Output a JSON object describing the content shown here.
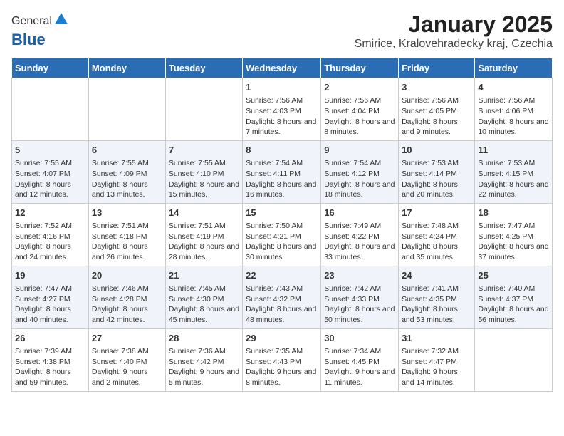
{
  "header": {
    "logo_general": "General",
    "logo_blue": "Blue",
    "month_title": "January 2025",
    "location": "Smirice, Kralovehradecky kraj, Czechia"
  },
  "days_of_week": [
    "Sunday",
    "Monday",
    "Tuesday",
    "Wednesday",
    "Thursday",
    "Friday",
    "Saturday"
  ],
  "weeks": [
    [
      {
        "day": "",
        "detail": ""
      },
      {
        "day": "",
        "detail": ""
      },
      {
        "day": "",
        "detail": ""
      },
      {
        "day": "1",
        "detail": "Sunrise: 7:56 AM\nSunset: 4:03 PM\nDaylight: 8 hours and 7 minutes."
      },
      {
        "day": "2",
        "detail": "Sunrise: 7:56 AM\nSunset: 4:04 PM\nDaylight: 8 hours and 8 minutes."
      },
      {
        "day": "3",
        "detail": "Sunrise: 7:56 AM\nSunset: 4:05 PM\nDaylight: 8 hours and 9 minutes."
      },
      {
        "day": "4",
        "detail": "Sunrise: 7:56 AM\nSunset: 4:06 PM\nDaylight: 8 hours and 10 minutes."
      }
    ],
    [
      {
        "day": "5",
        "detail": "Sunrise: 7:55 AM\nSunset: 4:07 PM\nDaylight: 8 hours and 12 minutes."
      },
      {
        "day": "6",
        "detail": "Sunrise: 7:55 AM\nSunset: 4:09 PM\nDaylight: 8 hours and 13 minutes."
      },
      {
        "day": "7",
        "detail": "Sunrise: 7:55 AM\nSunset: 4:10 PM\nDaylight: 8 hours and 15 minutes."
      },
      {
        "day": "8",
        "detail": "Sunrise: 7:54 AM\nSunset: 4:11 PM\nDaylight: 8 hours and 16 minutes."
      },
      {
        "day": "9",
        "detail": "Sunrise: 7:54 AM\nSunset: 4:12 PM\nDaylight: 8 hours and 18 minutes."
      },
      {
        "day": "10",
        "detail": "Sunrise: 7:53 AM\nSunset: 4:14 PM\nDaylight: 8 hours and 20 minutes."
      },
      {
        "day": "11",
        "detail": "Sunrise: 7:53 AM\nSunset: 4:15 PM\nDaylight: 8 hours and 22 minutes."
      }
    ],
    [
      {
        "day": "12",
        "detail": "Sunrise: 7:52 AM\nSunset: 4:16 PM\nDaylight: 8 hours and 24 minutes."
      },
      {
        "day": "13",
        "detail": "Sunrise: 7:51 AM\nSunset: 4:18 PM\nDaylight: 8 hours and 26 minutes."
      },
      {
        "day": "14",
        "detail": "Sunrise: 7:51 AM\nSunset: 4:19 PM\nDaylight: 8 hours and 28 minutes."
      },
      {
        "day": "15",
        "detail": "Sunrise: 7:50 AM\nSunset: 4:21 PM\nDaylight: 8 hours and 30 minutes."
      },
      {
        "day": "16",
        "detail": "Sunrise: 7:49 AM\nSunset: 4:22 PM\nDaylight: 8 hours and 33 minutes."
      },
      {
        "day": "17",
        "detail": "Sunrise: 7:48 AM\nSunset: 4:24 PM\nDaylight: 8 hours and 35 minutes."
      },
      {
        "day": "18",
        "detail": "Sunrise: 7:47 AM\nSunset: 4:25 PM\nDaylight: 8 hours and 37 minutes."
      }
    ],
    [
      {
        "day": "19",
        "detail": "Sunrise: 7:47 AM\nSunset: 4:27 PM\nDaylight: 8 hours and 40 minutes."
      },
      {
        "day": "20",
        "detail": "Sunrise: 7:46 AM\nSunset: 4:28 PM\nDaylight: 8 hours and 42 minutes."
      },
      {
        "day": "21",
        "detail": "Sunrise: 7:45 AM\nSunset: 4:30 PM\nDaylight: 8 hours and 45 minutes."
      },
      {
        "day": "22",
        "detail": "Sunrise: 7:43 AM\nSunset: 4:32 PM\nDaylight: 8 hours and 48 minutes."
      },
      {
        "day": "23",
        "detail": "Sunrise: 7:42 AM\nSunset: 4:33 PM\nDaylight: 8 hours and 50 minutes."
      },
      {
        "day": "24",
        "detail": "Sunrise: 7:41 AM\nSunset: 4:35 PM\nDaylight: 8 hours and 53 minutes."
      },
      {
        "day": "25",
        "detail": "Sunrise: 7:40 AM\nSunset: 4:37 PM\nDaylight: 8 hours and 56 minutes."
      }
    ],
    [
      {
        "day": "26",
        "detail": "Sunrise: 7:39 AM\nSunset: 4:38 PM\nDaylight: 8 hours and 59 minutes."
      },
      {
        "day": "27",
        "detail": "Sunrise: 7:38 AM\nSunset: 4:40 PM\nDaylight: 9 hours and 2 minutes."
      },
      {
        "day": "28",
        "detail": "Sunrise: 7:36 AM\nSunset: 4:42 PM\nDaylight: 9 hours and 5 minutes."
      },
      {
        "day": "29",
        "detail": "Sunrise: 7:35 AM\nSunset: 4:43 PM\nDaylight: 9 hours and 8 minutes."
      },
      {
        "day": "30",
        "detail": "Sunrise: 7:34 AM\nSunset: 4:45 PM\nDaylight: 9 hours and 11 minutes."
      },
      {
        "day": "31",
        "detail": "Sunrise: 7:32 AM\nSunset: 4:47 PM\nDaylight: 9 hours and 14 minutes."
      },
      {
        "day": "",
        "detail": ""
      }
    ]
  ]
}
